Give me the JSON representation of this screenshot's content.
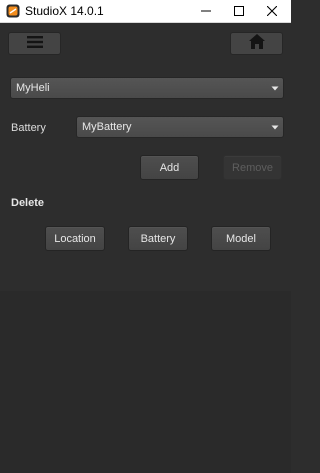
{
  "window": {
    "title": "StudioX 14.0.1",
    "minimize_icon": "minimize-icon",
    "maximize_icon": "maximize-icon",
    "close_icon": "close-icon"
  },
  "toolbar": {
    "menu_icon": "hamburger-menu-icon",
    "home_icon": "home-icon"
  },
  "model_select": {
    "value": "MyHeli"
  },
  "battery_row": {
    "label": "Battery",
    "select_value": "MyBattery"
  },
  "actions": {
    "add_label": "Add",
    "remove_label": "Remove",
    "remove_enabled": false
  },
  "delete_section": {
    "heading": "Delete",
    "location_label": "Location",
    "battery_label": "Battery",
    "model_label": "Model"
  },
  "colors": {
    "background": "#2d2d2d",
    "button": "#4a4a4a",
    "text": "#e6e6e6",
    "disabled_text": "#5e5e5e"
  }
}
